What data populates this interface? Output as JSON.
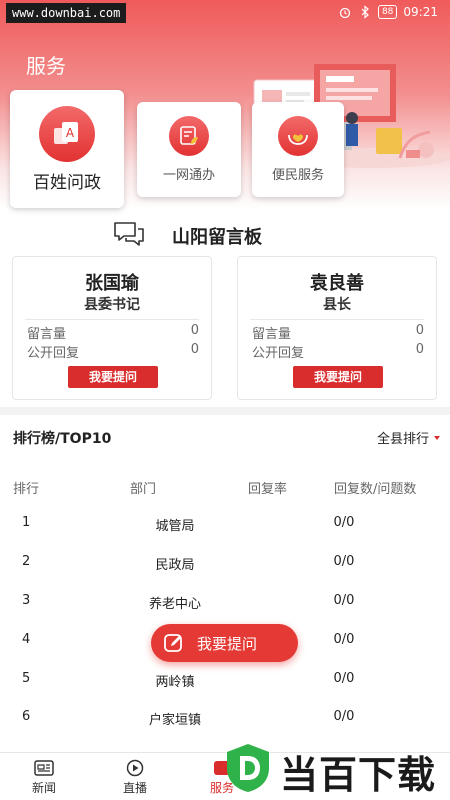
{
  "status_bar": {
    "watermark": "www.downbai.com",
    "battery": "88",
    "time": "09:21",
    "icons": [
      "alarm-icon",
      "bluetooth-icon",
      "battery-icon"
    ]
  },
  "header": {
    "title": "服务",
    "gradient_colors": [
      "#f05a5a",
      "#ffffff"
    ]
  },
  "services": [
    {
      "label": "百姓问政",
      "icon": "ask-document-icon"
    },
    {
      "label": "一网通办",
      "icon": "form-leaf-icon"
    },
    {
      "label": "便民服务",
      "icon": "heart-hands-icon"
    }
  ],
  "message_board": {
    "title": "山阳留言板",
    "icon": "chat-bubbles-icon",
    "leaders": [
      {
        "name": "张国瑜",
        "role": "县委书记",
        "message_label": "留言量",
        "message_count": "0",
        "reply_label": "公开回复",
        "reply_count": "0",
        "button": "我要提问"
      },
      {
        "name": "袁良善",
        "role": "县长",
        "message_label": "留言量",
        "message_count": "0",
        "reply_label": "公开回复",
        "reply_count": "0",
        "button": "我要提问"
      }
    ]
  },
  "ranking": {
    "title": "排行榜/TOP10",
    "filter": "全县排行",
    "columns": [
      "排行",
      "部门",
      "回复率",
      "回复数/问题数"
    ],
    "rows": [
      {
        "rank": "1",
        "dept": "城管局",
        "ratio": "0/0"
      },
      {
        "rank": "2",
        "dept": "民政局",
        "ratio": "0/0"
      },
      {
        "rank": "3",
        "dept": "养老中心",
        "ratio": "0/0"
      },
      {
        "rank": "4",
        "dept": "",
        "ratio": "0/0"
      },
      {
        "rank": "5",
        "dept": "两岭镇",
        "ratio": "0/0"
      },
      {
        "rank": "6",
        "dept": "户家垣镇",
        "ratio": "0/0"
      }
    ]
  },
  "fab": {
    "label": "我要提问",
    "icon": "edit-icon"
  },
  "tabs": [
    {
      "label": "新闻",
      "icon": "newspaper-icon"
    },
    {
      "label": "直播",
      "icon": "play-icon"
    },
    {
      "label": "服务",
      "icon": "service-icon"
    }
  ],
  "logo_watermark": {
    "text": "当百下载",
    "accent": "#2fb24a"
  },
  "accent_color": "#d92c2c"
}
